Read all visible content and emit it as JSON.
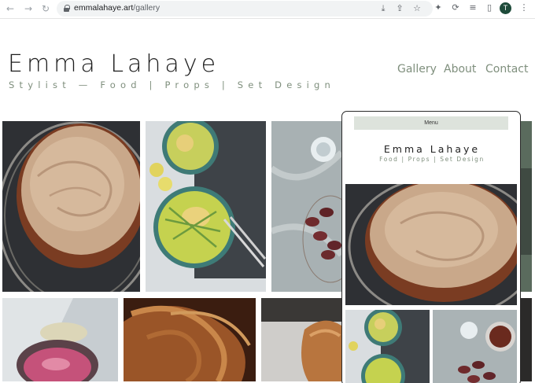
{
  "browser": {
    "back_icon": "back-arrow-icon",
    "forward_icon": "forward-arrow-icon",
    "reload_icon": "reload-icon",
    "url_host": "emmalahaye.art",
    "url_path": "/gallery",
    "profile_initial": "T"
  },
  "site": {
    "logo": "Emma Lahaye",
    "tagline": "Stylist — Food | Props | Set Design",
    "nav": [
      "Gallery",
      "About",
      "Contact"
    ],
    "accent_color": "#7f8f7d"
  },
  "mobile_preview": {
    "menu_label": "Menu",
    "logo": "Emma Lahaye",
    "tagline": "Food | Props | Set Design"
  }
}
